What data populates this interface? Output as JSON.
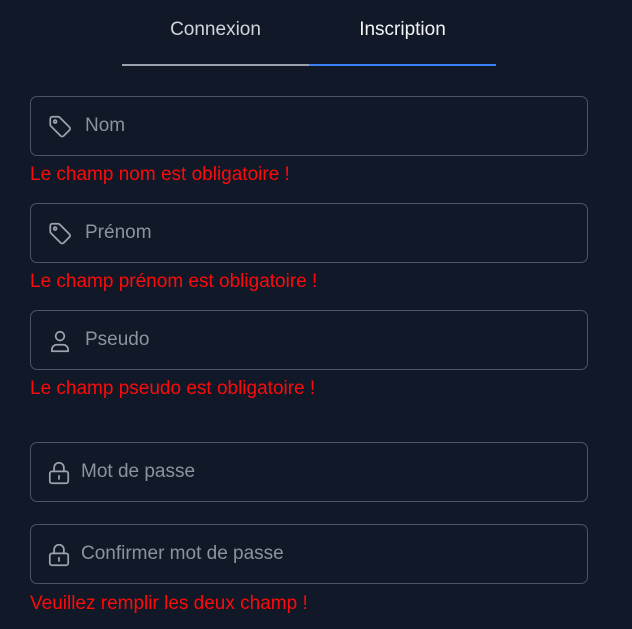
{
  "tabs": {
    "login_label": "Connexion",
    "register_label": "Inscription",
    "active": "register"
  },
  "form": {
    "nom": {
      "placeholder": "Nom",
      "value": "",
      "icon": "tag-icon",
      "error": "Le champ nom est obligatoire !"
    },
    "prenom": {
      "placeholder": "Prénom",
      "value": "",
      "icon": "tag-icon",
      "error": "Le champ prénom est obligatoire !"
    },
    "pseudo": {
      "placeholder": "Pseudo",
      "value": "",
      "icon": "user-icon",
      "error": "Le champ pseudo est obligatoire !"
    },
    "password": {
      "placeholder": "Mot de passe",
      "value": "",
      "icon": "lock-icon"
    },
    "confirm_password": {
      "placeholder": "Confirmer mot de passe",
      "value": "",
      "icon": "lock-icon"
    },
    "password_error": "Veuillez remplir les deux champ !"
  },
  "colors": {
    "background": "#111827",
    "border": "#4b5563",
    "error": "#ff0a0a",
    "accent": "#3b82f6",
    "placeholder": "#8b939f"
  }
}
